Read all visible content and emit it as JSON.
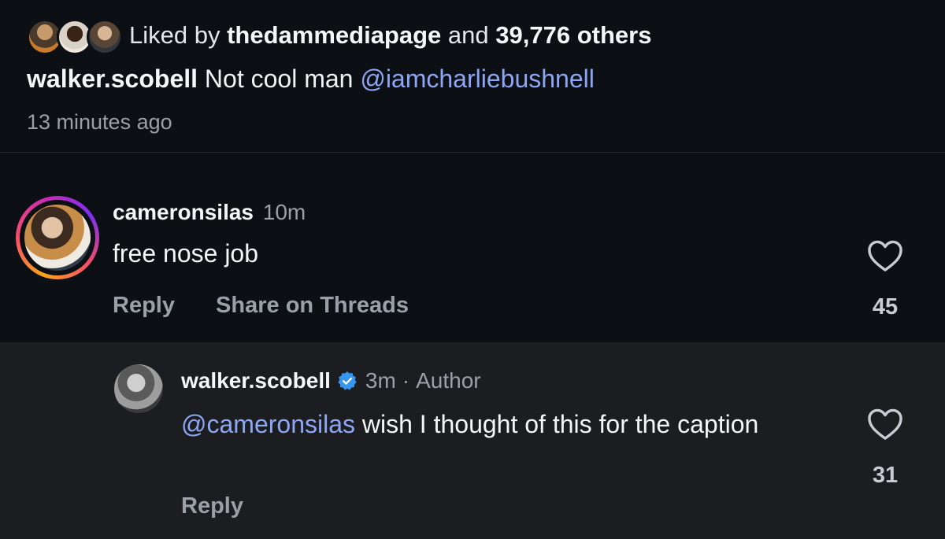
{
  "post": {
    "liked_by_prefix": "Liked by",
    "liked_by_user": "thedammediapage",
    "liked_by_mid": "and",
    "liked_by_count": "39,776 others",
    "caption_user": "walker.scobell",
    "caption_text": "Not cool man",
    "caption_mention": "@iamcharliebushnell",
    "timestamp": "13 minutes ago"
  },
  "comments": [
    {
      "username": "cameronsilas",
      "time": "10m",
      "text": "free nose job",
      "reply_label": "Reply",
      "share_label": "Share on Threads",
      "like_count": "45",
      "icons": {
        "avatar": "story-ring-avatar",
        "like": "heart-icon"
      }
    },
    {
      "username": "walker.scobell",
      "time": "3m",
      "separator": "·",
      "author_label": "Author",
      "mention": "@cameronsilas",
      "text": " wish I thought of this for the caption",
      "reply_label": "Reply",
      "like_count": "31",
      "icons": {
        "verified": "verified-badge-icon",
        "like": "heart-icon"
      }
    }
  ],
  "colors": {
    "background": "#0c0f14",
    "reply_background": "#1c1d21",
    "mention": "#8ea7f4",
    "muted": "#9aa0a8",
    "verified": "#3797f0"
  }
}
